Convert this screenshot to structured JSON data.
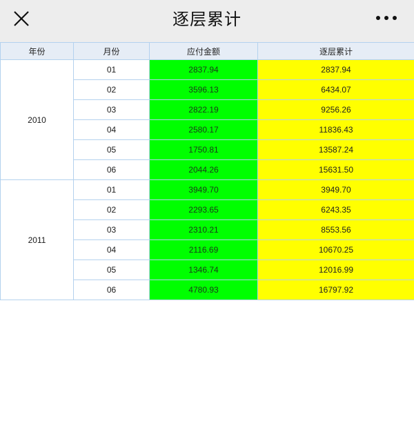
{
  "header": {
    "title": "逐层累计",
    "close_icon": "close-icon",
    "more_icon": "more-dots-icon"
  },
  "table": {
    "columns": [
      "年份",
      "月份",
      "应付金额",
      "逐层累计"
    ],
    "colors": {
      "header_bg": "#e6edf6",
      "border": "#b3d1ee",
      "amount_bg": "#00ff00",
      "cumulative_bg": "#ffff00"
    },
    "groups": [
      {
        "year": "2010",
        "rows": [
          {
            "month": "01",
            "amount": "2837.94",
            "cumulative": "2837.94"
          },
          {
            "month": "02",
            "amount": "3596.13",
            "cumulative": "6434.07"
          },
          {
            "month": "03",
            "amount": "2822.19",
            "cumulative": "9256.26"
          },
          {
            "month": "04",
            "amount": "2580.17",
            "cumulative": "11836.43"
          },
          {
            "month": "05",
            "amount": "1750.81",
            "cumulative": "13587.24"
          },
          {
            "month": "06",
            "amount": "2044.26",
            "cumulative": "15631.50"
          }
        ]
      },
      {
        "year": "2011",
        "rows": [
          {
            "month": "01",
            "amount": "3949.70",
            "cumulative": "3949.70"
          },
          {
            "month": "02",
            "amount": "2293.65",
            "cumulative": "6243.35"
          },
          {
            "month": "03",
            "amount": "2310.21",
            "cumulative": "8553.56"
          },
          {
            "month": "04",
            "amount": "2116.69",
            "cumulative": "10670.25"
          },
          {
            "month": "05",
            "amount": "1346.74",
            "cumulative": "12016.99"
          },
          {
            "month": "06",
            "amount": "4780.93",
            "cumulative": "16797.92"
          }
        ]
      }
    ]
  }
}
